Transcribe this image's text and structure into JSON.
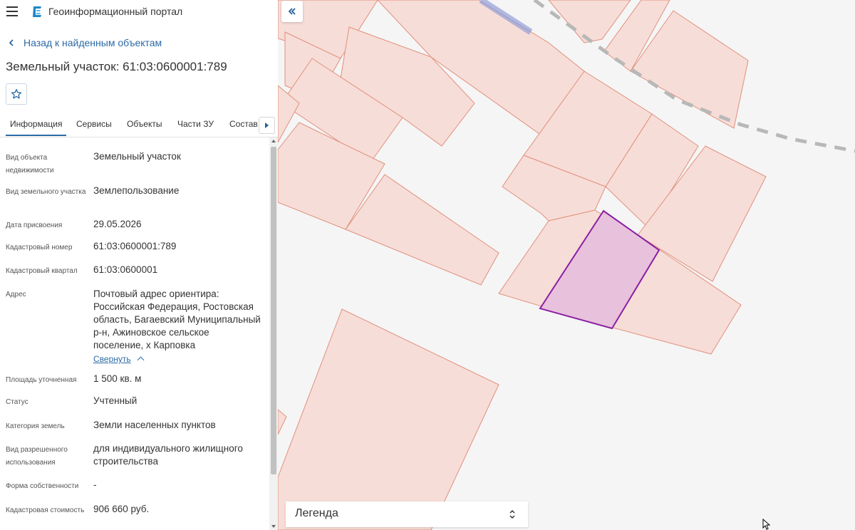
{
  "app": {
    "title": "Геоинформационный портал"
  },
  "nav": {
    "back_label": "Назад к найденным объектам"
  },
  "object": {
    "title": "Земельный участок: 61:03:0600001:789"
  },
  "tabs": [
    "Информация",
    "Сервисы",
    "Объекты",
    "Части ЗУ",
    "Состав"
  ],
  "info": [
    {
      "label": "Вид объекта недвижимости",
      "value": "Земельный участок"
    },
    {
      "label": "Вид земельного участка",
      "value": "Землепользование"
    },
    {
      "label": "Дата присвоения",
      "value": "29.05.2026"
    },
    {
      "label": "Кадастровый номер",
      "value": "61:03:0600001:789"
    },
    {
      "label": "Кадастровый квартал",
      "value": "61:03:0600001"
    },
    {
      "label": "Адрес",
      "value": "Почтовый адрес ориентира: Российская Федерация, Ростовская область, Багаевский Муниципальный р-н, Ажиновское сельское поселение, х Карповка"
    },
    {
      "label": "Площадь уточненная",
      "value": "1 500 кв. м"
    },
    {
      "label": "Статус",
      "value": "Учтенный"
    },
    {
      "label": "Категория земель",
      "value": "Земли населенных пунктов"
    },
    {
      "label": "Вид разрешенного использования",
      "value": "для индивидуального жилищного строительства"
    },
    {
      "label": "Форма собственности",
      "value": "-"
    },
    {
      "label": "Кадастровая стоимость",
      "value": "906 660 руб."
    }
  ],
  "address_toggle": "Свернуть",
  "legend": {
    "label": "Легенда"
  },
  "colors": {
    "accent": "#2c6aa6",
    "parcel_fill": "#f7ddd7",
    "parcel_stroke": "#e0907e",
    "selected_fill": "#e8c1dc",
    "selected_stroke": "#8a1fa3"
  },
  "icons": [
    "menu-icon",
    "portal-logo-icon",
    "chevron-left-icon",
    "star-icon",
    "caret-right-icon",
    "double-chevron-left-icon",
    "chevron-up-icon",
    "up-down-icon"
  ]
}
